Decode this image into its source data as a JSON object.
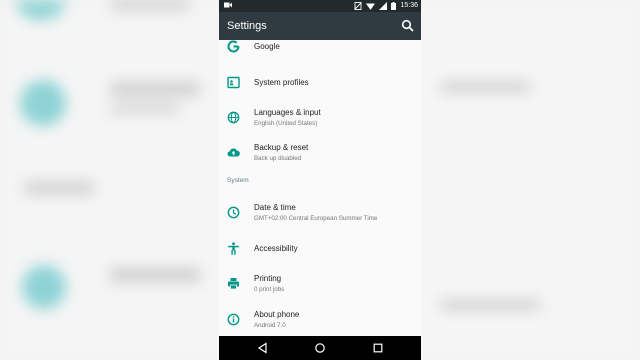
{
  "status_bar": {
    "time": "15:36"
  },
  "app_bar": {
    "title": "Settings"
  },
  "items": [
    {
      "id": "google",
      "title": "Google",
      "subtitle": "",
      "icon": "google-g-icon"
    },
    {
      "id": "system-profiles",
      "title": "System profiles",
      "subtitle": "",
      "icon": "profile-card-icon"
    },
    {
      "id": "languages",
      "title": "Languages & input",
      "subtitle": "English (United States)",
      "icon": "globe-icon"
    },
    {
      "id": "backup",
      "title": "Backup & reset",
      "subtitle": "Back up disabled",
      "icon": "cloud-upload-icon"
    },
    {
      "id": "date-time",
      "title": "Date & time",
      "subtitle": "GMT+02:00 Central European Summer Time",
      "icon": "clock-icon"
    },
    {
      "id": "accessibility",
      "title": "Accessibility",
      "subtitle": "",
      "icon": "accessibility-icon"
    },
    {
      "id": "printing",
      "title": "Printing",
      "subtitle": "0 print jobs",
      "icon": "printer-icon"
    },
    {
      "id": "about-phone",
      "title": "About phone",
      "subtitle": "Android 7.0",
      "icon": "info-icon"
    }
  ],
  "section": {
    "system_label": "System"
  },
  "colors": {
    "accent": "#009688",
    "app_bar": "#2f3b40",
    "status_bar": "#222a2e",
    "nav_bar": "#000000"
  }
}
